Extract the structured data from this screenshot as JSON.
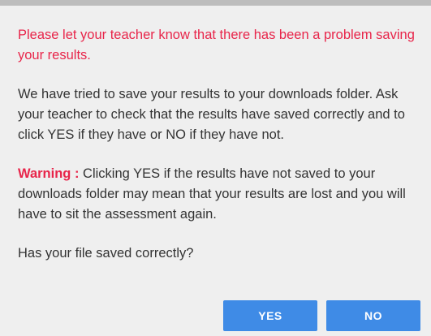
{
  "dialog": {
    "error_line": "Please let your teacher know that there has been a problem saving your results.",
    "info_text": "We have tried to save your results to your downloads folder. Ask your teacher to check that the results have saved correctly and to click YES if they have or NO if they have not.",
    "warning_label": "Warning :",
    "warning_text": " Clicking YES if the results have not saved to your downloads folder may mean that your results are lost and you will have to sit the assessment again.",
    "question": "Has your file saved correctly?",
    "yes_label": "YES",
    "no_label": "NO"
  },
  "colors": {
    "error_red": "#e8254a",
    "button_blue": "#3f8be6",
    "background": "#efefef"
  }
}
